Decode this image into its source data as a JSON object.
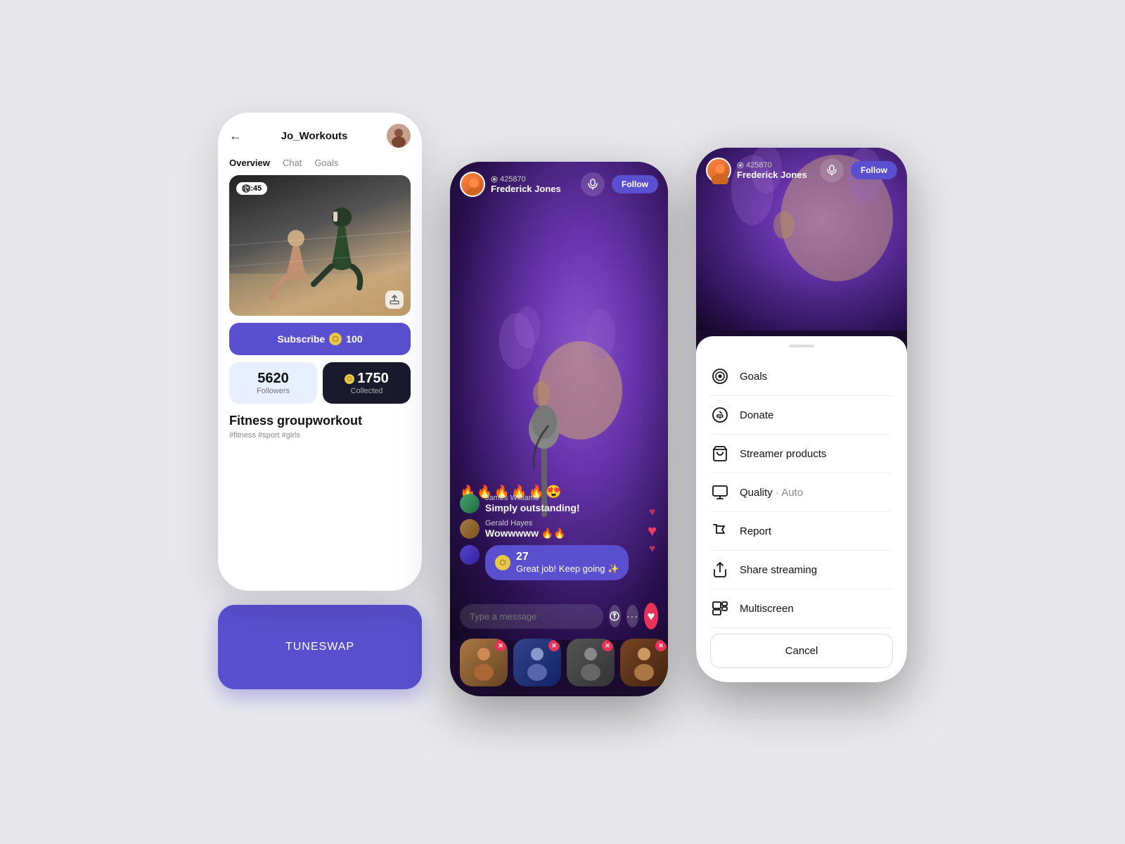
{
  "phone1": {
    "header": {
      "title": "Jo_Workouts",
      "back_icon": "←"
    },
    "tabs": [
      {
        "label": "Overview",
        "active": true
      },
      {
        "label": "Chat",
        "active": false
      },
      {
        "label": "Goals",
        "active": false
      }
    ],
    "video": {
      "time": "12:45"
    },
    "subscribe": {
      "label": "Subscribe",
      "coins": "100"
    },
    "stats": {
      "followers": {
        "value": "5620",
        "label": "Followers"
      },
      "collected": {
        "value": "1750",
        "label": "Collected"
      }
    },
    "workout": {
      "title": "Fitness groupworkout",
      "tags": "#fitness #sport #girls"
    }
  },
  "tuneswap": {
    "brand": "TUNE",
    "brand2": "SWAP"
  },
  "phone2": {
    "streamer": {
      "viewers": "425870",
      "name": "Frederick Jones",
      "follow": "Follow"
    },
    "chat": [
      {
        "user": "James Williams",
        "msg": "Simply outstanding!"
      },
      {
        "user": "Gerald Hayes",
        "msg": "Wowwwww 🔥🔥"
      }
    ],
    "coin_msg": {
      "amount": "27",
      "text": "Great job! Keep going ✨"
    },
    "input_placeholder": "Type a message",
    "emojis": "🔥🔥🔥🔥🔥😍"
  },
  "phone3": {
    "streamer": {
      "viewers": "425870",
      "name": "Frederick Jones",
      "follow": "Follow"
    },
    "menu": {
      "items": [
        {
          "icon": "goals",
          "label": "Goals"
        },
        {
          "icon": "donate",
          "label": "Donate"
        },
        {
          "icon": "shop",
          "label": "Streamer products"
        },
        {
          "icon": "quality",
          "label": "Quality",
          "sub": "Auto"
        },
        {
          "icon": "report",
          "label": "Report"
        },
        {
          "icon": "share",
          "label": "Share streaming"
        },
        {
          "icon": "multiscreen",
          "label": "Multiscreen"
        }
      ],
      "cancel": "Cancel"
    }
  }
}
